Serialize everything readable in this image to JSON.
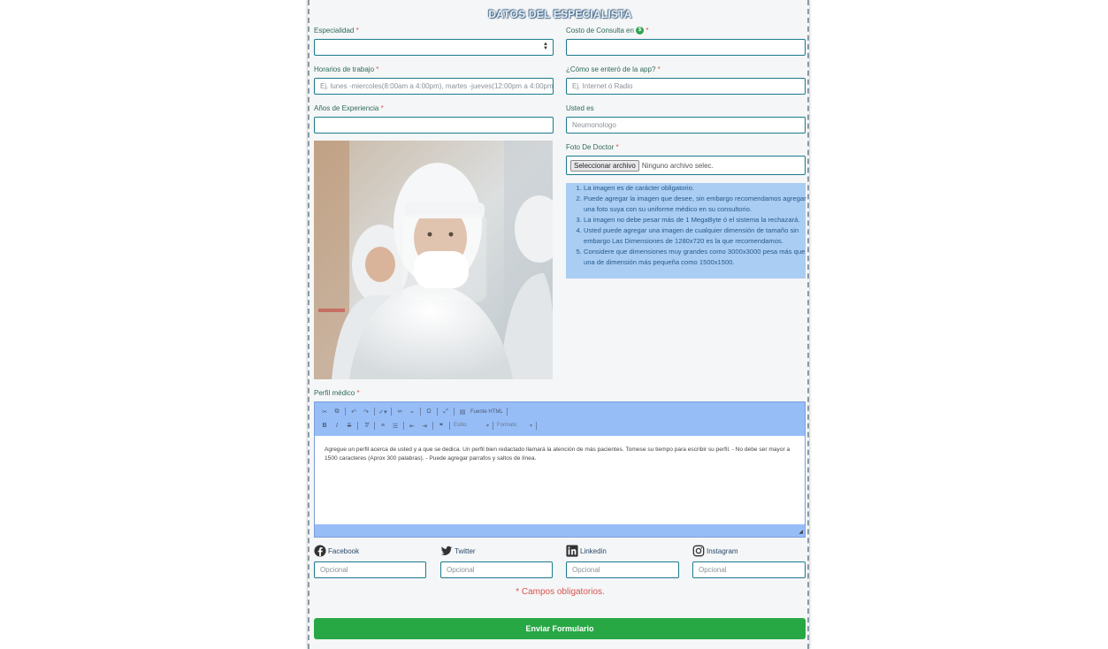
{
  "section_title": "DATOS DEL ESPECIALISTA",
  "required_mark": "*",
  "fields": {
    "specialty": {
      "label": "Especialidad",
      "value": ""
    },
    "consult_cost": {
      "label": "Costo de Consulta en",
      "currency_icon": "$",
      "value": ""
    },
    "schedule": {
      "label": "Horarios de trabajo",
      "placeholder": "Ej. lunes -miercoles(8:00am a 4:00pm), martes -jueves(12:00pm a 4:00pm)"
    },
    "found_app": {
      "label": "¿Cómo se enteró de la app?",
      "placeholder": "Ej. Internet ó Radio"
    },
    "experience": {
      "label": "Años de Experiencia",
      "value": ""
    },
    "you_are": {
      "label": "Usted es",
      "placeholder": "Neumonologo"
    },
    "photo": {
      "label": "Foto De Doctor",
      "button": "Seleccionar archivo",
      "status": "Ninguno archivo selec."
    },
    "profile": {
      "label": "Perfil médico"
    }
  },
  "photo_notes": [
    "La imagen es de carácter obligatorio.",
    "Puede agregar la imagen que desee, sin embargo recomendamos agregar una foto suya con su uniforme médico en su consultorio.",
    "La imagen no debe pesar más de 1 MegaByte ó el sistema la rechazará.",
    "Usted puede agregar una imagen de cualquier dimensión de tamaño sin embargo Las Dimensiones de 1280x720 es la que recomendamos.",
    "Considere que dimensiones muy grandes como 3000x3000 pesa más que una de dimensión más pequeña como 1500x1500."
  ],
  "editor": {
    "source_label": "Fuente HTML",
    "style_label": "Estilo",
    "format_label": "Formato",
    "body_text": "Agregue un perfil acerca de usted y a que se dedica. Un perfil bien redactado llamará la atención de más pacientes. Tomese su tiempo para escribir su perfil. - No debe ser mayor a 1500 caracteres (Aprox 300 palabras). - Puede agregar parrafos y saltos de línea."
  },
  "social": [
    {
      "name": "Facebook",
      "icon": "facebook-icon",
      "placeholder": "Opcional"
    },
    {
      "name": "Twitter",
      "icon": "twitter-icon",
      "placeholder": "Opcional"
    },
    {
      "name": "Linkedin",
      "icon": "linkedin-icon",
      "placeholder": "Opcional"
    },
    {
      "name": "Instagram",
      "icon": "instagram-icon",
      "placeholder": "Opcional"
    }
  ],
  "required_note": "* Campos obligatorios.",
  "submit_label": "Enviar Formulario",
  "colors": {
    "accent_border": "#1a7a8c",
    "required": "#d9534f",
    "submit": "#28a745",
    "editor_bar": "#97bdf7",
    "highlight": "#a9cdf3"
  }
}
